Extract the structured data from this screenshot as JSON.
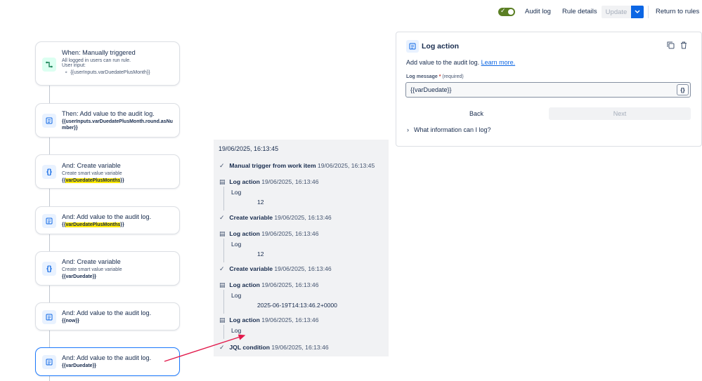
{
  "topbar": {
    "audit_log": "Audit log",
    "rule_details": "Rule details",
    "update": "Update",
    "return": "Return to rules"
  },
  "nodes": [
    {
      "title": "When: Manually triggered",
      "sub1": "All logged in users can run rule.",
      "sub2": "User input:",
      "bullet": "{{userInputs.varDuedatePlusMonth}}",
      "icon": "trigger-icon"
    },
    {
      "title": "Then: Add value to the audit log.",
      "code": "{{userInputs.varDuedatePlusMonth.round.asNumber}}",
      "icon": "log-icon"
    },
    {
      "title": "And: Create variable",
      "sub": "Create smart value variable",
      "code_pre": "{{",
      "code_hl": "varDuedatePlusMonths",
      "code_post": "}}",
      "icon": "braces-icon"
    },
    {
      "title": "And: Add value to the audit log.",
      "code_pre": "{{",
      "code_hl": "varDuedatePlusMonths",
      "code_post": "}}",
      "icon": "log-icon"
    },
    {
      "title": "And: Create variable",
      "sub": "Create smart value variable",
      "code": "{{varDuedate}}",
      "icon": "braces-icon"
    },
    {
      "title": "And: Add value to the audit log.",
      "code": "{{now}}",
      "icon": "log-icon"
    },
    {
      "title": "And: Add value to the audit log.",
      "code": "{{varDuedate}}",
      "icon": "log-icon"
    }
  ],
  "audit": {
    "header": "19/06/2025, 16:13:45",
    "entries": [
      {
        "label": "Manual trigger from work item",
        "ts": "19/06/2025, 16:13:45",
        "icon": "check-icon"
      },
      {
        "label": "Log action",
        "ts": "19/06/2025, 16:13:46",
        "icon": "log-icon",
        "log": "Log",
        "value": "12"
      },
      {
        "label": "Create variable",
        "ts": "19/06/2025, 16:13:46",
        "icon": "check-icon"
      },
      {
        "label": "Log action",
        "ts": "19/06/2025, 16:13:46",
        "icon": "log-icon",
        "log": "Log",
        "value": "12"
      },
      {
        "label": "Create variable",
        "ts": "19/06/2025, 16:13:46",
        "icon": "check-icon"
      },
      {
        "label": "Log action",
        "ts": "19/06/2025, 16:13:46",
        "icon": "log-icon",
        "log": "Log",
        "value": "2025-06-19T14:13:46.2+0000"
      },
      {
        "label": "Log action",
        "ts": "19/06/2025, 16:13:46",
        "icon": "log-icon",
        "log": "Log",
        "value": ""
      },
      {
        "label": "JQL condition",
        "ts": "19/06/2025, 16:13:46",
        "icon": "check-icon"
      }
    ]
  },
  "panel": {
    "title": "Log action",
    "desc": "Add value to the audit log.",
    "learn_more": "Learn more.",
    "field_label": "Log message",
    "required_mark": "*",
    "required_text": "(required)",
    "field_value": "{{varDuedate}}",
    "smart_button": "{}",
    "back": "Back",
    "next": "Next",
    "expander": "What information can I log?"
  },
  "colors": {
    "accent": "#0c66e4",
    "toggle_on": "#5b7f24",
    "highlight": "#ffe900",
    "arrow": "#e2194b"
  }
}
